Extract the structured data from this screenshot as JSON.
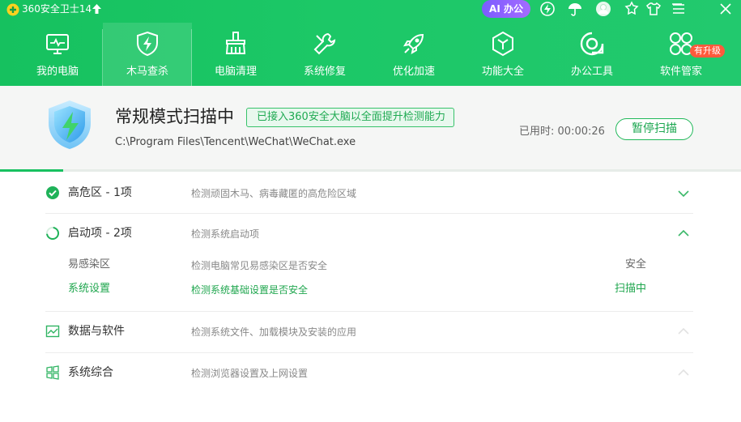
{
  "app": {
    "title": "360安全卫士14",
    "ai_label": "AI 办公"
  },
  "titlebar_icons": [
    "lightning-icon",
    "umbrella-icon",
    "user-avatar-icon",
    "skin-icon",
    "shirt-icon",
    "minimize-icon",
    "menu-icon",
    "close-icon"
  ],
  "nav": {
    "items": [
      {
        "label": "我的电脑",
        "icon": "computer-icon"
      },
      {
        "label": "木马查杀",
        "icon": "shield-lightning-icon"
      },
      {
        "label": "电脑清理",
        "icon": "broom-icon"
      },
      {
        "label": "系统修复",
        "icon": "wrench-icon"
      },
      {
        "label": "优化加速",
        "icon": "rocket-icon"
      },
      {
        "label": "功能大全",
        "icon": "cube-icon"
      },
      {
        "label": "办公工具",
        "icon": "office-icon"
      },
      {
        "label": "软件管家",
        "icon": "apps-icon"
      }
    ],
    "active_index": 1,
    "badge": "有升级"
  },
  "scan": {
    "title": "常规模式扫描中",
    "tip": "已接入360安全大脑以全面提升检测能力",
    "path": "C:\\Program Files\\Tencent\\WeChat\\WeChat.exe",
    "elapsed_label": "已用时:",
    "elapsed_value": "00:00:26",
    "pause_button": "暂停扫描",
    "progress": 0.085
  },
  "categories": [
    {
      "name": "高危区 -  1项",
      "desc": "检测顽固木马、病毒藏匿的高危险区域",
      "state": "done",
      "icon": "check-circle-icon"
    },
    {
      "name": "启动项 -  2项",
      "desc": "检测系统启动项",
      "state": "scanning",
      "icon": "spinner-icon",
      "children": [
        {
          "name": "易感染区",
          "desc": "检测电脑常见易感染区是否安全",
          "status": "安全",
          "active": false
        },
        {
          "name": "系统设置",
          "desc": "检测系统基础设置是否安全",
          "status": "扫描中",
          "active": true
        }
      ]
    },
    {
      "name": "数据与软件",
      "desc": "检测系统文件、加载模块及安装的应用",
      "state": "pending",
      "icon": "data-chart-icon"
    },
    {
      "name": "系统综合",
      "desc": "检测浏览器设置及上网设置",
      "state": "pending",
      "icon": "windows-icon"
    }
  ],
  "colors": {
    "brand_green": "#18c160",
    "accent_text_green": "#1fa64e",
    "ai_purple": "#8a62ff",
    "badge_red": "#ff5a3c"
  }
}
